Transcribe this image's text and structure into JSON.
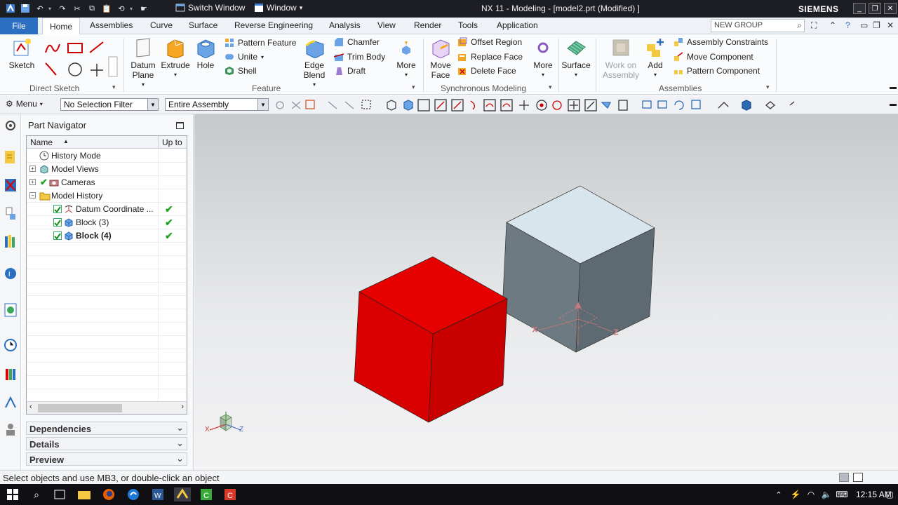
{
  "title_bar": {
    "switch_window": "Switch Window",
    "window_menu": "Window",
    "app_title": "NX 11 - Modeling - [model2.prt (Modified) ]",
    "brand": "SIEMENS"
  },
  "tabs": {
    "file": "File",
    "items": [
      "Home",
      "Assemblies",
      "Curve",
      "Surface",
      "Reverse Engineering",
      "Analysis",
      "View",
      "Render",
      "Tools",
      "Application"
    ],
    "command_search_placeholder": "NEW GROUP"
  },
  "ribbon": {
    "direct_sketch": {
      "sketch": "Sketch",
      "group_label": "Direct Sketch"
    },
    "feature": {
      "datum_plane": "Datum Plane",
      "extrude": "Extrude",
      "hole": "Hole",
      "pattern_feature": "Pattern Feature",
      "unite": "Unite",
      "shell": "Shell",
      "edge_blend": "Edge Blend",
      "chamfer": "Chamfer",
      "trim_body": "Trim Body",
      "draft": "Draft",
      "more": "More",
      "group_label": "Feature"
    },
    "synchronous": {
      "move_face": "Move Face",
      "offset_region": "Offset Region",
      "replace_face": "Replace Face",
      "delete_face": "Delete Face",
      "more": "More",
      "group_label": "Synchronous Modeling"
    },
    "surface": {
      "label": "Surface"
    },
    "assemblies": {
      "work_on_assembly": "Work on Assembly",
      "add": "Add",
      "assembly_constraints": "Assembly Constraints",
      "move_component": "Move Component",
      "pattern_component": "Pattern Component",
      "group_label": "Assemblies"
    }
  },
  "toolbar": {
    "menu": "Menu",
    "selection_filter": "No Selection Filter",
    "scope": "Entire Assembly"
  },
  "part_navigator": {
    "title": "Part Navigator",
    "col_name": "Name",
    "col_upto": "Up to",
    "rows": [
      {
        "label": "History Mode",
        "icon": "clock-icon",
        "expander": "",
        "checked": false,
        "upto": false,
        "bold": false
      },
      {
        "label": "Model Views",
        "icon": "model-views-icon",
        "expander": "+",
        "checked": false,
        "upto": false,
        "bold": false
      },
      {
        "label": "Cameras",
        "icon": "camera-icon",
        "expander": "+",
        "checked": false,
        "upto": false,
        "bold": false
      },
      {
        "label": "Model History",
        "icon": "folder-icon",
        "expander": "−",
        "checked": false,
        "upto": false,
        "bold": false
      },
      {
        "label": "Datum Coordinate ...",
        "icon": "datum-csys-icon",
        "expander": "",
        "checked": true,
        "upto": true,
        "bold": false
      },
      {
        "label": "Block (3)",
        "icon": "block-icon",
        "expander": "",
        "checked": true,
        "upto": true,
        "bold": false
      },
      {
        "label": "Block (4)",
        "icon": "block-icon",
        "expander": "",
        "checked": true,
        "upto": true,
        "bold": true
      }
    ],
    "panels": [
      "Dependencies",
      "Details",
      "Preview"
    ]
  },
  "status_line": "Select objects and use MB3, or double-click an object",
  "taskbar": {
    "clock": "12:15 AM"
  },
  "colors": {
    "accent": "#2a6fc0",
    "red_block": "#e10000",
    "grey_block": "#6b7880"
  }
}
